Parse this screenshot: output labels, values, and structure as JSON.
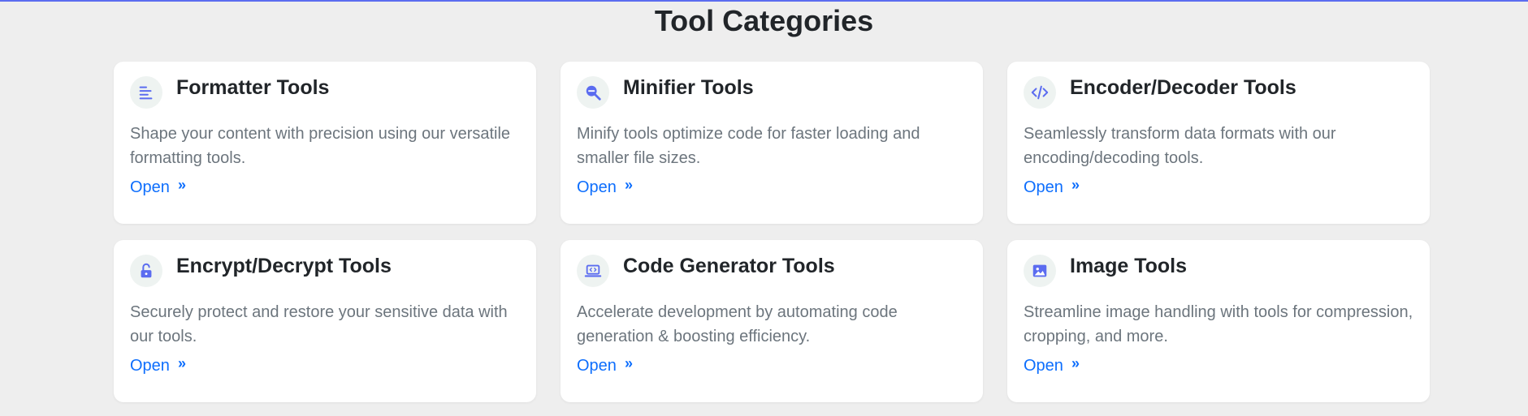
{
  "page": {
    "title": "Tool Categories"
  },
  "colors": {
    "accent": "#5b6cf0",
    "link": "#0d6efd",
    "icon_bg": "#eef3f1"
  },
  "cards": [
    {
      "title": "Formatter Tools",
      "description": "Shape your content with precision using our versatile formatting tools.",
      "link_label": "Open",
      "icon": "align-left-icon"
    },
    {
      "title": "Minifier Tools",
      "description": "Minify tools optimize code for faster loading and smaller file sizes.",
      "link_label": "Open",
      "icon": "search-minus-icon"
    },
    {
      "title": "Encoder/Decoder Tools",
      "description": "Seamlessly transform data formats with our encoding/decoding tools.",
      "link_label": "Open",
      "icon": "code-icon"
    },
    {
      "title": "Encrypt/Decrypt Tools",
      "description": "Securely protect and restore your sensitive data with our tools.",
      "link_label": "Open",
      "icon": "unlock-icon"
    },
    {
      "title": "Code Generator Tools",
      "description": "Accelerate development by automating code generation & boosting efficiency.",
      "link_label": "Open",
      "icon": "laptop-code-icon"
    },
    {
      "title": "Image Tools",
      "description": "Streamline image handling with tools for compression, cropping, and more.",
      "link_label": "Open",
      "icon": "image-icon"
    }
  ]
}
